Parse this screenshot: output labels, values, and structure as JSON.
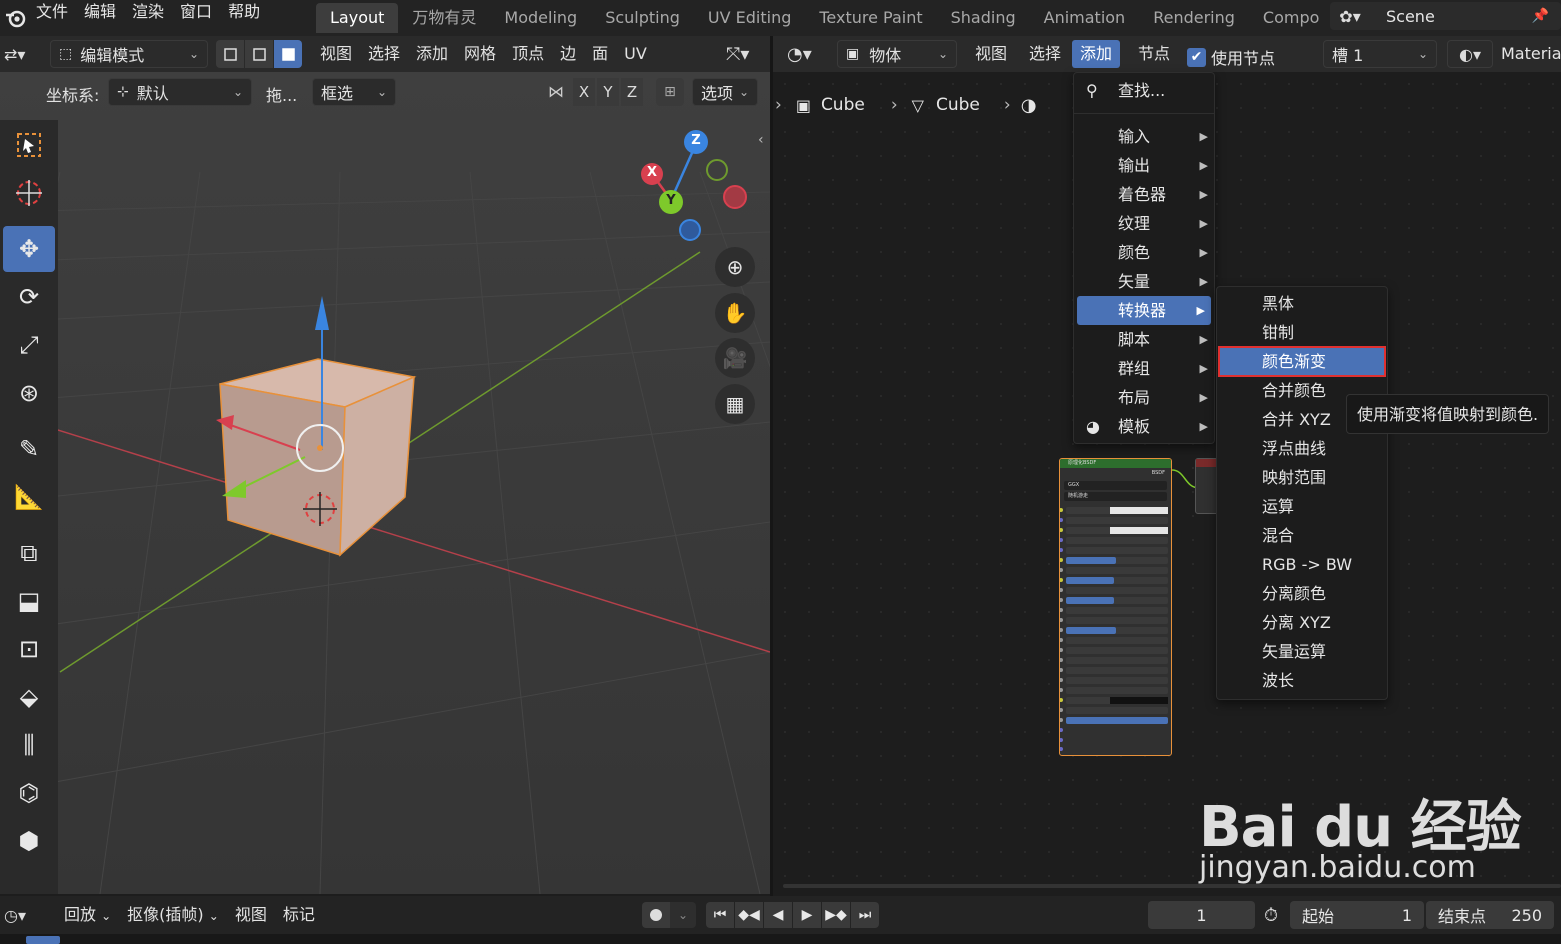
{
  "topbar": {
    "menus": [
      "文件",
      "编辑",
      "渲染",
      "窗口",
      "帮助"
    ],
    "workspaces": [
      "Layout",
      "万物有灵",
      "Modeling",
      "Sculpting",
      "UV Editing",
      "Texture Paint",
      "Shading",
      "Animation",
      "Rendering",
      "Compo"
    ],
    "active_workspace": "Layout",
    "scene": "Scene"
  },
  "viewport_header": {
    "mode": "编辑模式",
    "menus": [
      "视图",
      "选择",
      "添加",
      "网格",
      "顶点",
      "边",
      "面",
      "UV"
    ],
    "orientation_label": "坐标系:",
    "orientation_value": "默认",
    "drag_label": "拖...",
    "select_mode": "框选",
    "axes": [
      "X",
      "Y",
      "Z"
    ],
    "options_label": "选项"
  },
  "gizmo": {
    "x_label": "X",
    "y_label": "Y",
    "z_label": "Z"
  },
  "node_header": {
    "object_dropdown": "物体",
    "menus": [
      "视图",
      "选择"
    ],
    "add_label": "添加",
    "node_label": "节点",
    "use_nodes_label": "使用节点",
    "slot": "槽 1",
    "material": "Materia",
    "breadcrumb": [
      "Cube",
      "Cube"
    ]
  },
  "add_menu": {
    "search": "查找...",
    "items": [
      "输入",
      "输出",
      "着色器",
      "纹理",
      "颜色",
      "矢量",
      "转换器",
      "脚本",
      "群组",
      "布局",
      "模板"
    ],
    "active": "转换器"
  },
  "converter_menu": {
    "items": [
      "黑体",
      "钳制",
      "颜色渐变",
      "合并颜色",
      "合并 XYZ",
      "浮点曲线",
      "映射范围",
      "运算",
      "混合",
      "RGB -> BW",
      "分离颜色",
      "分离 XYZ",
      "矢量运算",
      "波长"
    ],
    "active": "颜色渐变"
  },
  "tooltip": "使用渐变将值映射到颜色.",
  "bsdf_node": {
    "title": "原理化BSDF",
    "output": "BSDF",
    "distribution": "GGX",
    "subsurface": "随机游走"
  },
  "timeline": {
    "menus": [
      "回放",
      "抠像(插帧)",
      "视图",
      "标记"
    ],
    "current_frame": "1",
    "start_label": "起始",
    "start_value": "1",
    "end_label": "结束点",
    "end_value": "250"
  },
  "watermark": {
    "brand": "Bai du 经验",
    "url": "jingyan.baidu.com"
  },
  "colors": {
    "accent": "#4a72b6",
    "highlight_border": "#e03030",
    "x_axis": "#d8404f",
    "y_axis": "#7ec92b",
    "z_axis": "#3a85e0"
  }
}
